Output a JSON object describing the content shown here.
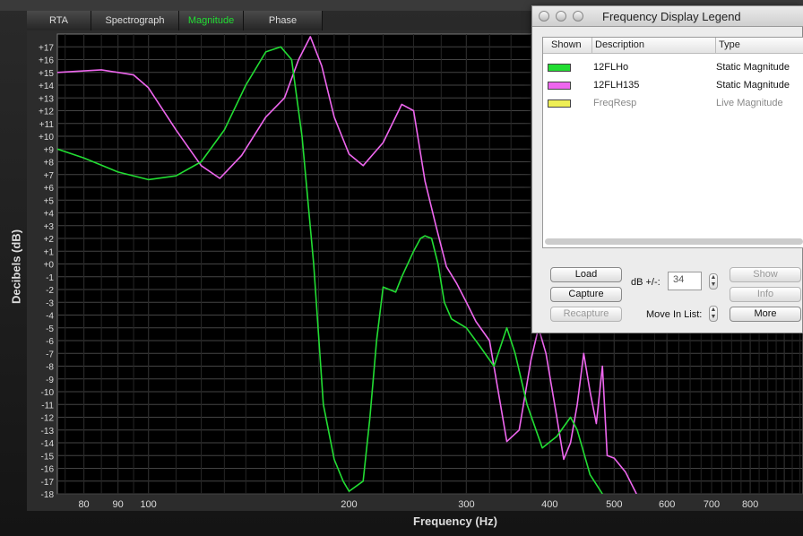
{
  "tabs": [
    {
      "label": "RTA"
    },
    {
      "label": "Spectrograph"
    },
    {
      "label": "Magnitude",
      "active": true
    },
    {
      "label": "Phase"
    }
  ],
  "axes": {
    "ylabel": "Decibels (dB)",
    "xlabel": "Frequency (Hz)"
  },
  "legend_window": {
    "title": "Frequency Display Legend",
    "columns": [
      "Shown",
      "Description",
      "Type"
    ],
    "rows": [
      {
        "color": "#22dd33",
        "description": "12FLHo",
        "type": "Static Magnitude",
        "dim": false
      },
      {
        "color": "#ee66ee",
        "description": "12FLH135",
        "type": "Static Magnitude",
        "dim": false
      },
      {
        "color": "#eeee55",
        "description": "FreqResp",
        "type": "Live Magnitude",
        "dim": true
      }
    ],
    "buttons": {
      "load": "Load",
      "capture": "Capture",
      "recapture": "Recapture",
      "show": "Show",
      "info": "Info",
      "more": "More"
    },
    "db_label": "dB +/-:",
    "db_value": "34",
    "move_label": "Move In List:"
  },
  "chart_data": {
    "type": "line",
    "xlabel": "Frequency (Hz)",
    "ylabel": "Decibels (dB)",
    "x_scale": "log",
    "xlim": [
      73,
      960
    ],
    "ylim": [
      -18,
      18
    ],
    "x_ticks": [
      "80",
      "90",
      "100",
      "200",
      "300",
      "400",
      "500",
      "600",
      "700",
      "800"
    ],
    "y_ticks": [
      "+17",
      "+16",
      "+15",
      "+14",
      "+13",
      "+12",
      "+11",
      "+10",
      "+9",
      "+8",
      "+7",
      "+6",
      "+5",
      "+4",
      "+3",
      "+2",
      "+1",
      "+0",
      "-1",
      "-2",
      "-3",
      "-4",
      "-5",
      "-6",
      "-7",
      "-8",
      "-9",
      "-10",
      "-11",
      "-12",
      "-13",
      "-14",
      "-15",
      "-16",
      "-17",
      "-18"
    ],
    "grid": true,
    "series": [
      {
        "name": "12FLHo",
        "color": "#22dd33",
        "points": [
          [
            73,
            9
          ],
          [
            80,
            8.3
          ],
          [
            90,
            7.2
          ],
          [
            100,
            6.6
          ],
          [
            110,
            6.9
          ],
          [
            120,
            8
          ],
          [
            130,
            10.5
          ],
          [
            140,
            14
          ],
          [
            150,
            16.6
          ],
          [
            158,
            17
          ],
          [
            164,
            16
          ],
          [
            170,
            10
          ],
          [
            177,
            0
          ],
          [
            183,
            -11
          ],
          [
            190,
            -15.3
          ],
          [
            196,
            -17
          ],
          [
            200,
            -17.8
          ],
          [
            210,
            -17
          ],
          [
            215,
            -12
          ],
          [
            220,
            -6
          ],
          [
            225,
            -1.8
          ],
          [
            235,
            -2.2
          ],
          [
            240,
            -1
          ],
          [
            250,
            1
          ],
          [
            256,
            2
          ],
          [
            260,
            2.2
          ],
          [
            266,
            2
          ],
          [
            272,
            0
          ],
          [
            278,
            -3
          ],
          [
            285,
            -4.3
          ],
          [
            300,
            -5
          ],
          [
            315,
            -6.5
          ],
          [
            330,
            -8
          ],
          [
            345,
            -5
          ],
          [
            355,
            -7
          ],
          [
            370,
            -11
          ],
          [
            390,
            -14.4
          ],
          [
            410,
            -13.5
          ],
          [
            430,
            -12
          ],
          [
            440,
            -13
          ],
          [
            460,
            -16.5
          ],
          [
            480,
            -18
          ]
        ]
      },
      {
        "name": "12FLH135",
        "color": "#ee66ee",
        "points": [
          [
            73,
            15
          ],
          [
            85,
            15.2
          ],
          [
            95,
            14.8
          ],
          [
            100,
            13.8
          ],
          [
            110,
            10.5
          ],
          [
            120,
            7.7
          ],
          [
            128,
            6.7
          ],
          [
            138,
            8.5
          ],
          [
            150,
            11.5
          ],
          [
            160,
            13
          ],
          [
            168,
            16
          ],
          [
            175,
            17.8
          ],
          [
            182,
            15.5
          ],
          [
            190,
            11.5
          ],
          [
            200,
            8.6
          ],
          [
            210,
            7.7
          ],
          [
            225,
            9.5
          ],
          [
            240,
            12.5
          ],
          [
            250,
            12
          ],
          [
            260,
            6.5
          ],
          [
            270,
            3
          ],
          [
            280,
            -0.2
          ],
          [
            290,
            -1.5
          ],
          [
            300,
            -3
          ],
          [
            310,
            -4.5
          ],
          [
            325,
            -6
          ],
          [
            335,
            -10
          ],
          [
            345,
            -13.9
          ],
          [
            360,
            -13
          ],
          [
            375,
            -7.5
          ],
          [
            385,
            -5
          ],
          [
            395,
            -7
          ],
          [
            410,
            -12
          ],
          [
            420,
            -15.3
          ],
          [
            430,
            -14
          ],
          [
            440,
            -11
          ],
          [
            450,
            -7
          ],
          [
            460,
            -10
          ],
          [
            470,
            -12.5
          ],
          [
            480,
            -8
          ],
          [
            488,
            -15
          ],
          [
            500,
            -15.2
          ],
          [
            520,
            -16.3
          ],
          [
            540,
            -18
          ]
        ]
      }
    ]
  }
}
